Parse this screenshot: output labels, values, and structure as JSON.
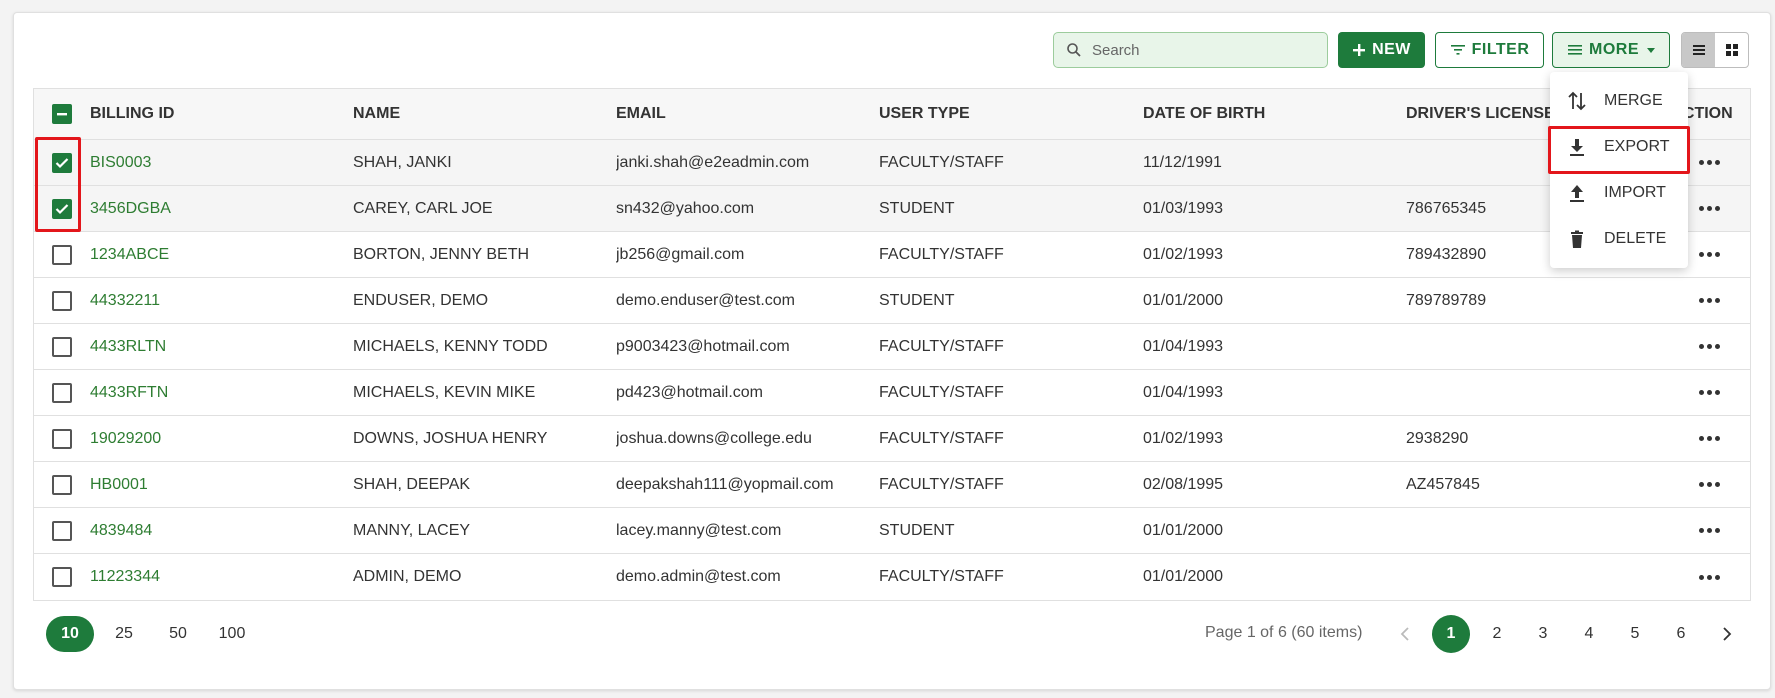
{
  "toolbar": {
    "search_placeholder": "Search",
    "new_label": "NEW",
    "filter_label": "FILTER",
    "more_label": "MORE"
  },
  "menu": {
    "merge": "MERGE",
    "export": "EXPORT",
    "import": "IMPORT",
    "delete": "DELETE"
  },
  "table": {
    "headers": {
      "billing_id": "BILLING ID",
      "name": "NAME",
      "email": "EMAIL",
      "user_type": "USER TYPE",
      "dob": "DATE OF BIRTH",
      "dl": "DRIVER'S LICENSE",
      "action": "ACTION"
    },
    "rows": [
      {
        "billing_id": "BIS0003",
        "name": "SHAH, JANKI",
        "email": "janki.shah@e2eadmin.com",
        "user_type": "FACULTY/STAFF",
        "dob": "11/12/1991",
        "dl": ""
      },
      {
        "billing_id": "3456DGBA",
        "name": "CAREY, CARL JOE",
        "email": "sn432@yahoo.com",
        "user_type": "STUDENT",
        "dob": "01/03/1993",
        "dl": "786765345"
      },
      {
        "billing_id": "1234ABCE",
        "name": "BORTON, JENNY BETH",
        "email": "jb256@gmail.com",
        "user_type": "FACULTY/STAFF",
        "dob": "01/02/1993",
        "dl": "789432890"
      },
      {
        "billing_id": "44332211",
        "name": "ENDUSER, DEMO",
        "email": "demo.enduser@test.com",
        "user_type": "STUDENT",
        "dob": "01/01/2000",
        "dl": "789789789"
      },
      {
        "billing_id": "4433RLTN",
        "name": "MICHAELS, KENNY TODD",
        "email": "p9003423@hotmail.com",
        "user_type": "FACULTY/STAFF",
        "dob": "01/04/1993",
        "dl": ""
      },
      {
        "billing_id": "4433RFTN",
        "name": "MICHAELS, KEVIN MIKE",
        "email": "pd423@hotmail.com",
        "user_type": "FACULTY/STAFF",
        "dob": "01/04/1993",
        "dl": ""
      },
      {
        "billing_id": "19029200",
        "name": "DOWNS, JOSHUA HENRY",
        "email": "joshua.downs@college.edu",
        "user_type": "FACULTY/STAFF",
        "dob": "01/02/1993",
        "dl": "2938290"
      },
      {
        "billing_id": "HB0001",
        "name": "SHAH, DEEPAK",
        "email": "deepakshah111@yopmail.com",
        "user_type": "FACULTY/STAFF",
        "dob": "02/08/1995",
        "dl": "AZ457845"
      },
      {
        "billing_id": "4839484",
        "name": "MANNY, LACEY",
        "email": "lacey.manny@test.com",
        "user_type": "STUDENT",
        "dob": "01/01/2000",
        "dl": ""
      },
      {
        "billing_id": "11223344",
        "name": "ADMIN, DEMO",
        "email": "demo.admin@test.com",
        "user_type": "FACULTY/STAFF",
        "dob": "01/01/2000",
        "dl": ""
      }
    ]
  },
  "footer": {
    "page_sizes": [
      "10",
      "25",
      "50",
      "100"
    ],
    "page_info": "Page 1 of 6 (60 items)",
    "pages": [
      "1",
      "2",
      "3",
      "4",
      "5",
      "6"
    ]
  },
  "colors": {
    "accent": "#1e7b3c",
    "highlight": "#e3161b"
  }
}
